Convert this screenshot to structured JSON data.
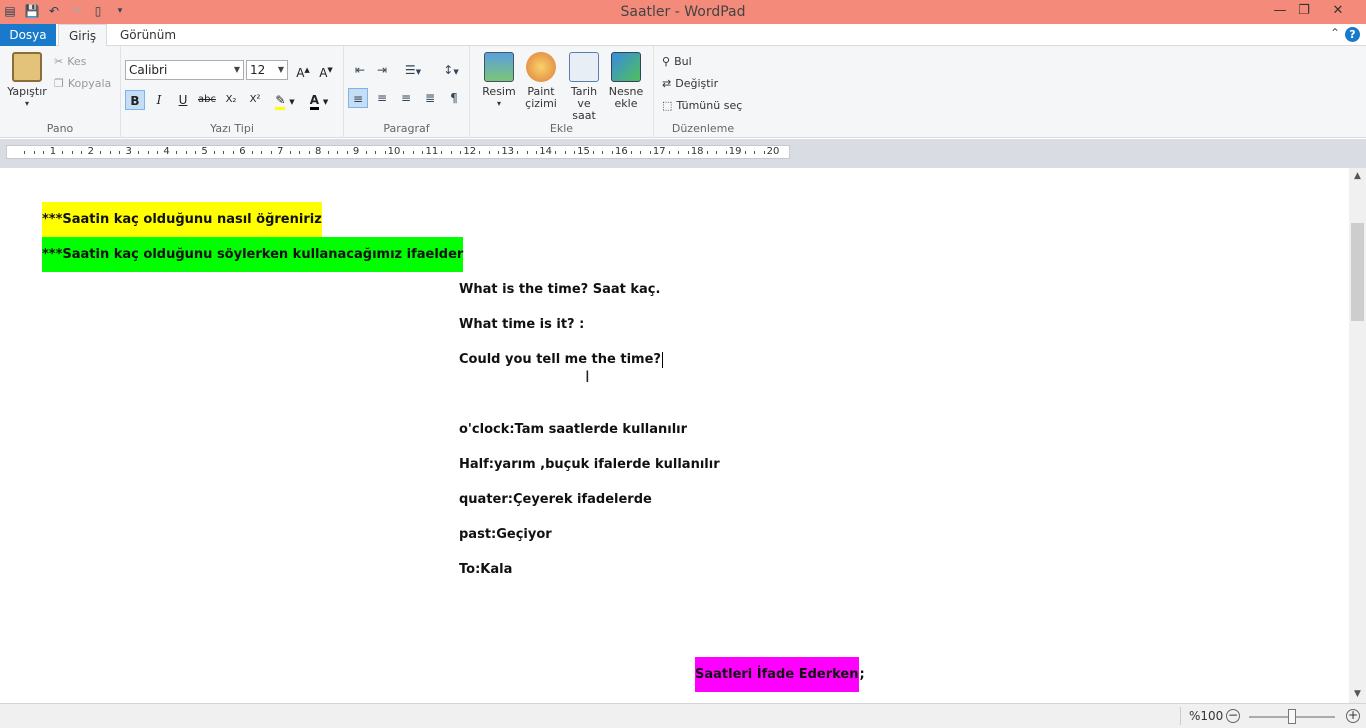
{
  "window": {
    "title": "Saatler - WordPad"
  },
  "qat": {
    "icons": [
      "wordpad-app-icon",
      "save-icon",
      "undo-icon",
      "redo-icon",
      "new-doc-icon"
    ]
  },
  "tabs": {
    "file": "Dosya",
    "home": "Giriş",
    "view": "Görünüm",
    "help": "?"
  },
  "clipboard": {
    "paste": "Yapıştır",
    "cut": "Kes",
    "copy": "Kopyala",
    "group": "Pano"
  },
  "font": {
    "family": "Calibri",
    "size": "12",
    "group": "Yazı Tipi",
    "bold": "B",
    "italic": "I",
    "underline": "U",
    "strike": "abc",
    "sub": "X₂",
    "sup": "X²"
  },
  "paragraph": {
    "group": "Paragraf"
  },
  "insert": {
    "picture": "Resim",
    "paint1": "Paint",
    "paint2": "çizimi",
    "datetime1": "Tarih",
    "datetime2": "ve saat",
    "object1": "Nesne",
    "object2": "ekle",
    "group": "Ekle"
  },
  "editing": {
    "find": "Bul",
    "replace": "Değiştir",
    "selectall": "Tümünü seç",
    "group": "Düzenleme"
  },
  "ruler": {
    "numbers": [
      "1",
      "2",
      "3",
      "4",
      "5",
      "6",
      "7",
      "8",
      "9",
      "10",
      "11",
      "12",
      "13",
      "14",
      "15",
      "16",
      "17",
      "18",
      "19",
      "20"
    ]
  },
  "document": {
    "line1": "***Saatin kaç olduğunu nasıl öğreniriz",
    "line2": "***Saatin kaç olduğunu söylerken kullanacağımız ifaelder",
    "line3": "What is the time? Saat kaç.",
    "line4": "What time is it? :",
    "line5": "Could you tell me the time?",
    "line6": "o'clock:Tam saatlerde kullanılır",
    "line7": "Half:yarım ,buçuk ifalerde kullanılır",
    "line8": "quater:Çeyerek ifadelerde",
    "line9": "past:Geçiyor",
    "line10": "To:Kala",
    "line11": "Saatleri İfade Ederken",
    "line11_tail": ";"
  },
  "status": {
    "zoom": "%100"
  },
  "colors": {
    "titlebar": "#f48a7a",
    "fileTab": "#1979ca",
    "highlightYellow": "#ffff00",
    "highlightGreen": "#00ff00",
    "highlightMagenta": "#ff00ff"
  }
}
